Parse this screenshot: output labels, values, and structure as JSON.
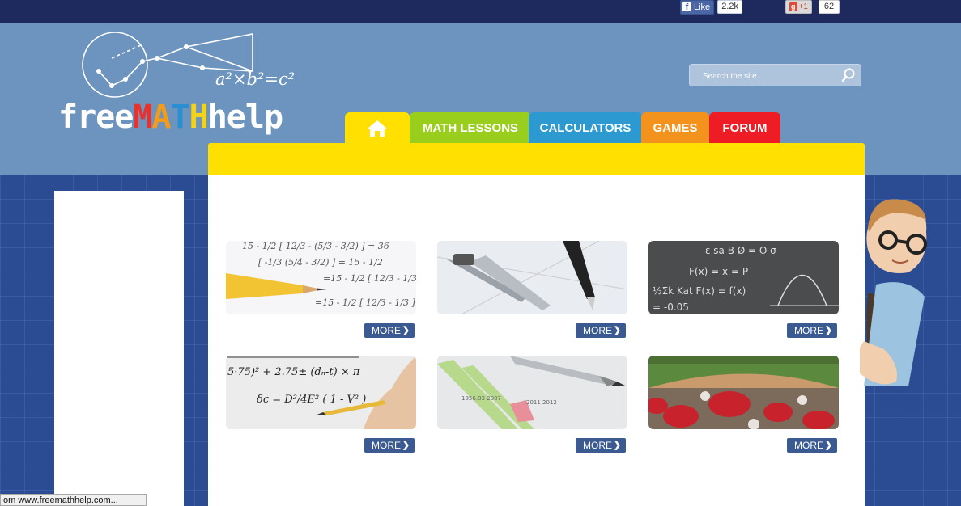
{
  "social": {
    "fb_like_label": "Like",
    "fb_like_count": "2.2k",
    "gplus_label": "+1",
    "gplus_count": "62"
  },
  "logo": {
    "part1": "free",
    "m": "M",
    "a": "A",
    "t": "T",
    "h": "H",
    "part2": "help",
    "formula": "a²×b²=c²"
  },
  "search": {
    "placeholder": "Search the site..."
  },
  "nav": {
    "home_icon": "home-icon",
    "tabs": [
      {
        "label": "MATH LESSONS",
        "color": "#99cf1c"
      },
      {
        "label": "CALCULATORS",
        "color": "#2c9ad1"
      },
      {
        "label": "GAMES",
        "color": "#f4921e"
      },
      {
        "label": "FORUM",
        "color": "#ee1c24"
      }
    ]
  },
  "cards": [
    {
      "image": "pencil-on-equations",
      "more": "MORE"
    },
    {
      "image": "compass-and-pen",
      "more": "MORE"
    },
    {
      "image": "chalkboard-formulas",
      "more": "MORE"
    },
    {
      "image": "hand-writing-formula",
      "more": "MORE"
    },
    {
      "image": "pen-on-bar-chart",
      "more": "MORE"
    },
    {
      "image": "baseball-stadium-crowd",
      "more": "MORE"
    }
  ],
  "status_bar": {
    "text": "om www.freemathhelp.com..."
  },
  "colors": {
    "topbar": "#1e2a5e",
    "header": "#6c94be",
    "nav_yellow": "#ffe000",
    "more_button": "#3b5a91"
  }
}
